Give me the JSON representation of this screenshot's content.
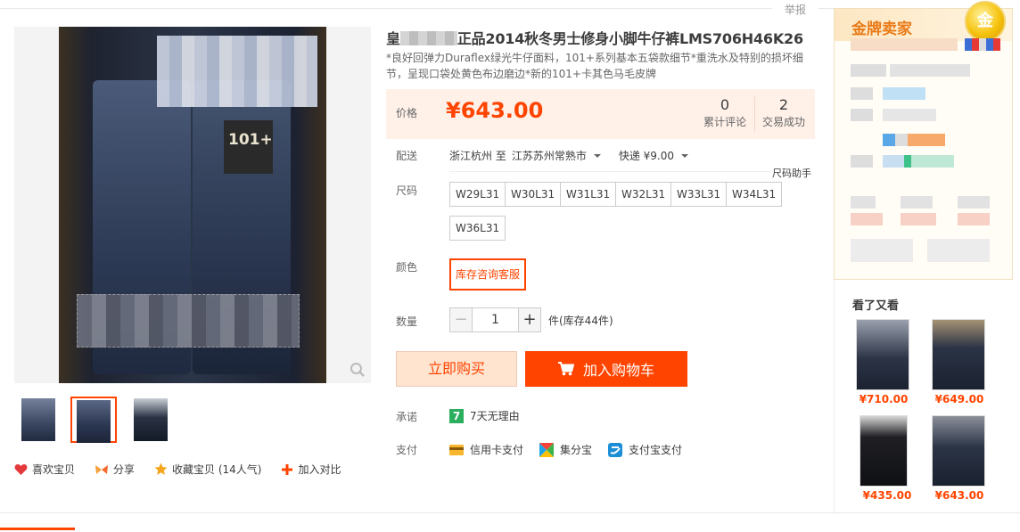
{
  "report_label": "举报",
  "product": {
    "title_prefix": "皇",
    "title_suffix": "正品2014秋冬男士修身小脚牛仔裤LMS706H46K26",
    "subtitle": "*良好回弹力Duraflex绿光牛仔面料，101+系列基本五袋款细节*重洗水及特别的损坏细节，呈现口袋处黄色布边磨边*新的101+卡其色马毛皮牌",
    "image_tag": "101+"
  },
  "price": {
    "label": "价格",
    "value": "¥643.00",
    "reviews_count": "0",
    "reviews_label": "累计评论",
    "sales_count": "2",
    "sales_label": "交易成功"
  },
  "delivery": {
    "label": "配送",
    "from": "浙江杭州 至",
    "to": "江苏苏州常熟市",
    "shipping": "快递 ¥9.00"
  },
  "size": {
    "label": "尺码",
    "helper": "尺码助手",
    "options": [
      "W29L31",
      "W30L31",
      "W31L31",
      "W32L31",
      "W33L31",
      "W34L31",
      "W36L31"
    ]
  },
  "color": {
    "label": "颜色",
    "option": "库存咨询客服"
  },
  "quantity": {
    "label": "数量",
    "value": "1",
    "minus": "−",
    "plus": "+",
    "stock": "件(库存44件)"
  },
  "buttons": {
    "buy_now": "立即购买",
    "add_to_cart": "加入购物车"
  },
  "promise": {
    "label": "承诺",
    "badge": "7",
    "text": "7天无理由"
  },
  "payment": {
    "label": "支付",
    "methods": [
      "信用卡支付",
      "集分宝",
      "支付宝支付"
    ]
  },
  "actions": {
    "like": "喜欢宝贝",
    "share": "分享",
    "favorite": "收藏宝贝 (14人气)",
    "compare": "加入对比"
  },
  "seller": {
    "title": "金牌卖家",
    "medal": "金"
  },
  "watched": {
    "title": "看了又看",
    "items": [
      {
        "price": "¥710.00"
      },
      {
        "price": "¥649.00"
      },
      {
        "price": "¥435.00"
      },
      {
        "price": "¥643.00"
      }
    ]
  },
  "colors": {
    "accent": "#ff4400",
    "price_bg": "#fff0e8",
    "buy_bg": "#ffe4d0",
    "seller_title": "#e97a17"
  }
}
